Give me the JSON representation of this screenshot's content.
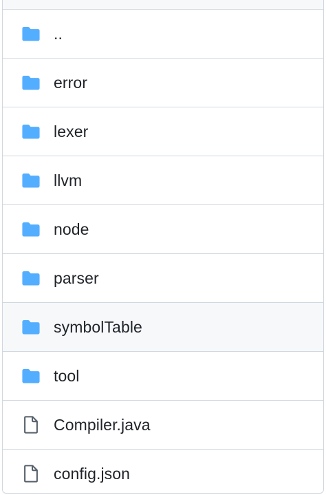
{
  "colors": {
    "folder": "#54aeff",
    "file": "#57606a",
    "border": "#d0d7de",
    "highlight": "#f6f8fa",
    "text": "#1f2328"
  },
  "entries": [
    {
      "name": "..",
      "icon": "folder-icon"
    },
    {
      "name": "error",
      "icon": "folder-icon"
    },
    {
      "name": "lexer",
      "icon": "folder-icon"
    },
    {
      "name": "llvm",
      "icon": "folder-icon"
    },
    {
      "name": "node",
      "icon": "folder-icon"
    },
    {
      "name": "parser",
      "icon": "folder-icon"
    },
    {
      "name": "symbolTable",
      "icon": "folder-icon",
      "hovered": true
    },
    {
      "name": "tool",
      "icon": "folder-icon"
    },
    {
      "name": "Compiler.java",
      "icon": "file-icon"
    },
    {
      "name": "config.json",
      "icon": "file-icon"
    }
  ]
}
